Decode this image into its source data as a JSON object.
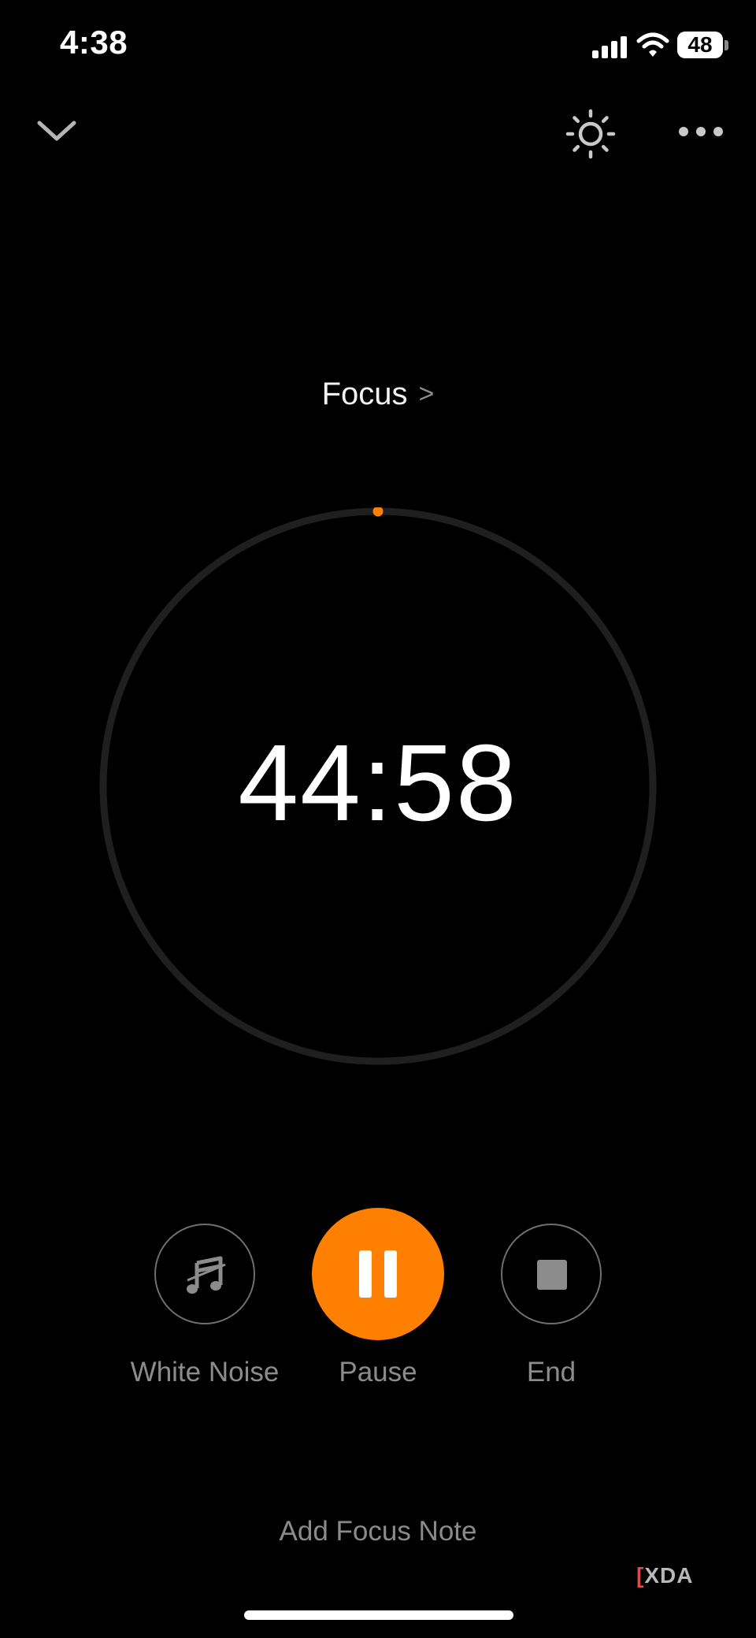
{
  "status_bar": {
    "time": "4:38",
    "battery_level": "48"
  },
  "top_bar": {
    "collapse_icon": "chevron-down-icon",
    "theme_icon": "sun-icon",
    "more_icon": "more-horizontal-icon"
  },
  "session": {
    "label": "Focus",
    "label_chevron": ">",
    "remaining_time": "44:58",
    "progress_fraction": 0.0
  },
  "controls": {
    "white_noise_label": "White Noise",
    "pause_label": "Pause",
    "end_label": "End"
  },
  "footer": {
    "add_note_label": "Add Focus Note"
  },
  "watermark": {
    "text": "XDA"
  },
  "colors": {
    "accent": "#ff8000",
    "background": "#000000",
    "ring_track": "#1f1f1f",
    "muted_text": "#8c8c8c"
  }
}
